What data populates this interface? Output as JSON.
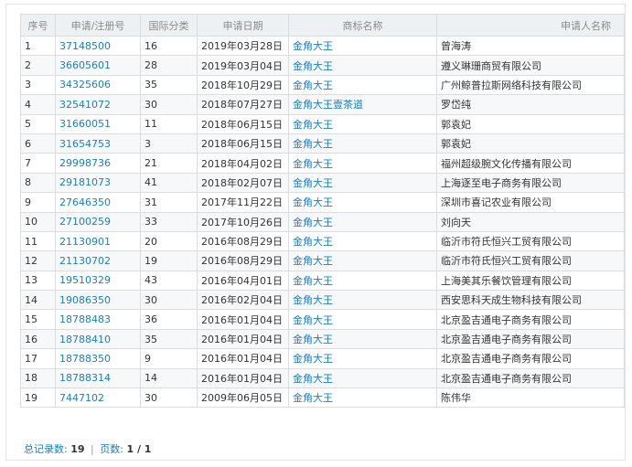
{
  "table": {
    "headers": [
      "序号",
      "申请/注册号",
      "国际分类",
      "申请日期",
      "商标名称",
      "申请人名称"
    ],
    "rows": [
      {
        "no": "1",
        "reg": "37148500",
        "cls": "16",
        "date": "2019年03月28日",
        "mark": "金角大王",
        "applicant": "曾海涛"
      },
      {
        "no": "2",
        "reg": "36605601",
        "cls": "28",
        "date": "2019年03月04日",
        "mark": "金角大王",
        "applicant": "遵义琳珊商贸有限公司"
      },
      {
        "no": "3",
        "reg": "34325606",
        "cls": "35",
        "date": "2018年10月29日",
        "mark": "金角大王",
        "applicant": "广州鲸普拉斯网络科技有限公司"
      },
      {
        "no": "4",
        "reg": "32541072",
        "cls": "30",
        "date": "2018年07月27日",
        "mark": "金角大王壹茶道",
        "applicant": "罗岱纯"
      },
      {
        "no": "5",
        "reg": "31660051",
        "cls": "11",
        "date": "2018年06月15日",
        "mark": "金角大王",
        "applicant": "郭袁妃"
      },
      {
        "no": "6",
        "reg": "31654753",
        "cls": "3",
        "date": "2018年06月15日",
        "mark": "金角大王",
        "applicant": "郭袁妃"
      },
      {
        "no": "7",
        "reg": "29998736",
        "cls": "21",
        "date": "2018年04月02日",
        "mark": "金角大王",
        "applicant": "福州超级腕文化传播有限公司"
      },
      {
        "no": "8",
        "reg": "29181073",
        "cls": "41",
        "date": "2018年02月07日",
        "mark": "金角大王",
        "applicant": "上海逐至电子商务有限公司"
      },
      {
        "no": "9",
        "reg": "27646350",
        "cls": "31",
        "date": "2017年11月22日",
        "mark": "金角大王",
        "applicant": "深圳市喜记农业有限公司"
      },
      {
        "no": "10",
        "reg": "27100259",
        "cls": "33",
        "date": "2017年10月26日",
        "mark": "金角大王",
        "applicant": "刘向天"
      },
      {
        "no": "11",
        "reg": "21130901",
        "cls": "20",
        "date": "2016年08月29日",
        "mark": "金角大王",
        "applicant": "临沂市符氏恒兴工贸有限公司"
      },
      {
        "no": "12",
        "reg": "21130702",
        "cls": "19",
        "date": "2016年08月29日",
        "mark": "金角大王",
        "applicant": "临沂市符氏恒兴工贸有限公司"
      },
      {
        "no": "13",
        "reg": "19510329",
        "cls": "43",
        "date": "2016年04月01日",
        "mark": "金角大王",
        "applicant": "上海美其乐餐饮管理有限公司"
      },
      {
        "no": "14",
        "reg": "19086350",
        "cls": "30",
        "date": "2016年02月04日",
        "mark": "金角大王",
        "applicant": "西安思科天成生物科技有限公司"
      },
      {
        "no": "15",
        "reg": "18788483",
        "cls": "36",
        "date": "2016年01月04日",
        "mark": "金角大王",
        "applicant": "北京盈吉通电子商务有限公司"
      },
      {
        "no": "16",
        "reg": "18788410",
        "cls": "35",
        "date": "2016年01月04日",
        "mark": "金角大王",
        "applicant": "北京盈吉通电子商务有限公司"
      },
      {
        "no": "17",
        "reg": "18788350",
        "cls": "9",
        "date": "2016年01月04日",
        "mark": "金角大王",
        "applicant": "北京盈吉通电子商务有限公司"
      },
      {
        "no": "18",
        "reg": "18788314",
        "cls": "14",
        "date": "2016年01月04日",
        "mark": "金角大王",
        "applicant": "北京盈吉通电子商务有限公司"
      },
      {
        "no": "19",
        "reg": "7447102",
        "cls": "30",
        "date": "2009年06月05日",
        "mark": "金角大王",
        "applicant": "陈伟华"
      }
    ]
  },
  "footer": {
    "total_label": "总记录数:",
    "total_value": "19",
    "separator": "|",
    "pages_label": "页数:",
    "pages_value": "1 / 1"
  },
  "colors": {
    "link": "#1a7fc1",
    "header_bg": "#eef1f3",
    "border": "#dcdcdc"
  }
}
